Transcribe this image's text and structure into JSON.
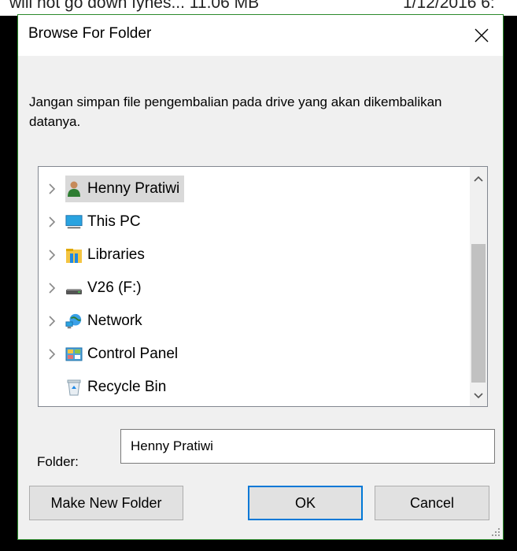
{
  "background_strip": {
    "text_left": "will not go down fynes...  11.06 MB",
    "text_right": "1/12/2016 6:"
  },
  "dialog": {
    "title": "Browse For Folder",
    "instruction": "Jangan simpan file pengembalian pada drive yang akan dikembalikan datanya.",
    "tree": [
      {
        "label": "Henny Pratiwi",
        "icon": "user-icon",
        "expandable": true,
        "selected": true
      },
      {
        "label": "This PC",
        "icon": "computer-icon",
        "expandable": true,
        "selected": false
      },
      {
        "label": "Libraries",
        "icon": "libraries-icon",
        "expandable": true,
        "selected": false
      },
      {
        "label": "V26 (F:)",
        "icon": "drive-icon",
        "expandable": true,
        "selected": false
      },
      {
        "label": "Network",
        "icon": "network-icon",
        "expandable": true,
        "selected": false
      },
      {
        "label": "Control Panel",
        "icon": "control-panel-icon",
        "expandable": true,
        "selected": false
      },
      {
        "label": "Recycle Bin",
        "icon": "recycle-bin-icon",
        "expandable": false,
        "selected": false
      }
    ],
    "folder_label": "Folder:",
    "folder_value": "Henny Pratiwi",
    "buttons": {
      "make_new_folder": "Make New Folder",
      "ok": "OK",
      "cancel": "Cancel"
    }
  },
  "colors": {
    "selection": "#d9d9d9",
    "default_button_border": "#0078d7",
    "dialog_border": "#2a8a2a"
  }
}
